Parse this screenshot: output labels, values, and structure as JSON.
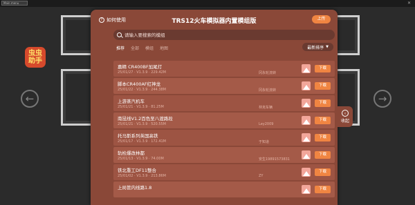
{
  "background": {
    "menu_label": "Main menu",
    "badge_text": "虫虫\n助手",
    "badge_line1": "虫虫",
    "badge_line2": "助手"
  },
  "modal": {
    "help_label": "如何使用",
    "title": "TRS12火车模拟器内置模组版",
    "upload_label": "上传",
    "search_placeholder": "请输入要搜索的模组",
    "filters": [
      "推荐",
      "全部",
      "模组",
      "地图"
    ],
    "sort_label": "最新排序",
    "collapse_label": "收起",
    "download_label": "下载"
  },
  "mods": [
    {
      "name": "嘉精 CR400BF加尾灯",
      "date": "25/01/27",
      "version": "V1.3.9",
      "size": "229.42M",
      "author": "冈永轮流转"
    },
    {
      "name": "脚本CR400AF红神龙",
      "date": "25/01/22",
      "version": "V1.3.9",
      "size": "244.38M",
      "author": "冈永轮流转"
    },
    {
      "name": "上游蒸汽机车",
      "date": "25/01/21",
      "version": "V1.3.9",
      "size": "81.25M",
      "author": "林克车辆"
    },
    {
      "name": "南昆线V1.2百色至八渡路段",
      "date": "25/01/21",
      "version": "V1.3.9",
      "size": "520.55M",
      "author": "Ley2009"
    },
    {
      "name": "托马斯系列英国高铁",
      "date": "25/01/17",
      "version": "V1.3.9",
      "size": "172.41M",
      "author": "于知道"
    },
    {
      "name": "轨检爆改林都",
      "date": "25/01/13",
      "version": "V1.3.9",
      "size": "74.00M",
      "author": "安生19891573831"
    },
    {
      "name": "铁北重工DF11整合",
      "date": "25/01/02",
      "version": "V1.3.9",
      "size": "213.86M",
      "author": "ZY"
    },
    {
      "name": "上局管内线路1.8",
      "date": "",
      "version": "",
      "size": "",
      "author": ""
    }
  ]
}
